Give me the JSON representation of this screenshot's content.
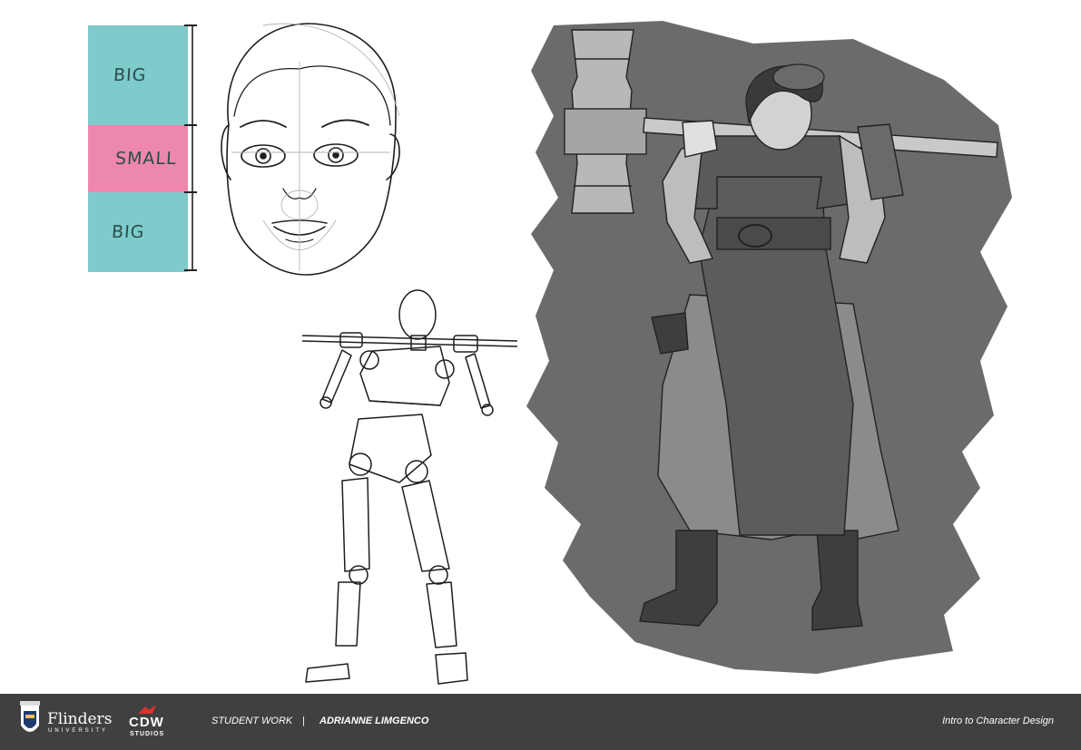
{
  "proportion_chart": {
    "top_label": "BIG",
    "middle_label": "SMALL",
    "bottom_label": "BIG",
    "colors": {
      "big": "#7ecbcc",
      "small": "#ee87ad"
    }
  },
  "footer": {
    "university_name": "Flinders",
    "university_sub": "UNIVERSITY",
    "studio_logo_main": "CDW",
    "studio_logo_sub": "STUDIOS",
    "category": "STUDENT WORK",
    "separator": "|",
    "author": "ADRIANNE LIMGENCO",
    "course": "Intro to Character Design",
    "background": "#404041"
  }
}
